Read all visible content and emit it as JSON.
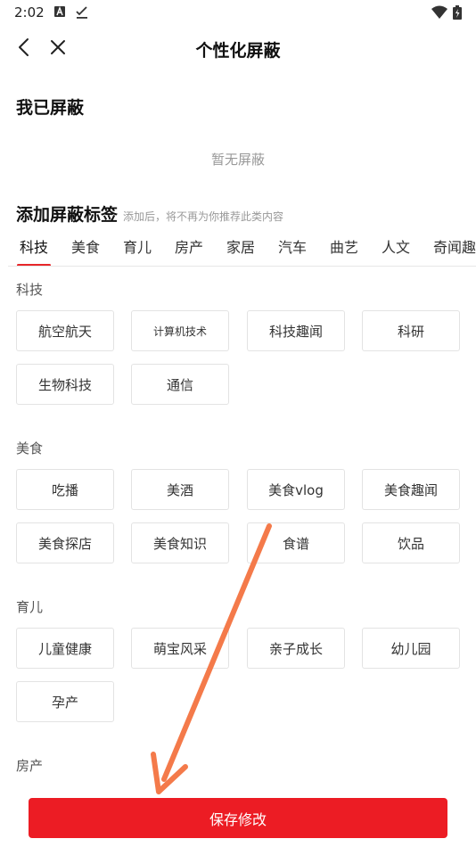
{
  "status_bar": {
    "time": "2:02"
  },
  "nav": {
    "title": "个性化屏蔽"
  },
  "blocked": {
    "title": "我已屏蔽",
    "empty_text": "暂无屏蔽"
  },
  "add": {
    "title": "添加屏蔽标签",
    "hint": "添加后，将不再为你推荐此类内容"
  },
  "tabs": [
    "科技",
    "美食",
    "育儿",
    "房产",
    "家居",
    "汽车",
    "曲艺",
    "人文",
    "奇闻趣事"
  ],
  "categories": [
    {
      "name": "科技",
      "tags": [
        "航空航天",
        "计算机技术",
        "科技趣闻",
        "科研",
        "生物科技",
        "通信"
      ]
    },
    {
      "name": "美食",
      "tags": [
        "吃播",
        "美酒",
        "美食vlog",
        "美食趣闻",
        "美食探店",
        "美食知识",
        "食谱",
        "饮品"
      ]
    },
    {
      "name": "育儿",
      "tags": [
        "儿童健康",
        "萌宝风采",
        "亲子成长",
        "幼儿园",
        "孕产"
      ]
    },
    {
      "name": "房产",
      "tags": []
    }
  ],
  "save_label": "保存修改",
  "colors": {
    "accent": "#ec1c24",
    "arrow": "#f47a4a"
  }
}
